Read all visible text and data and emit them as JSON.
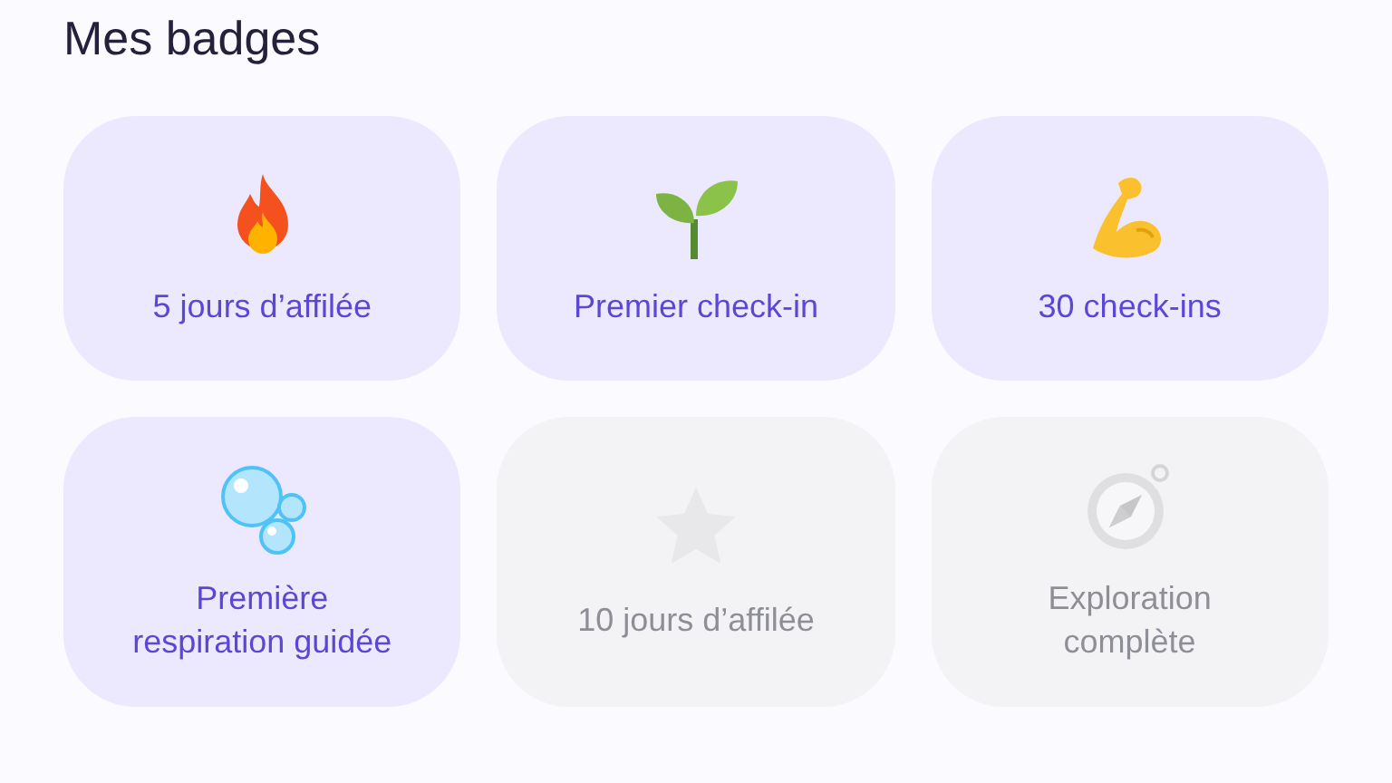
{
  "title": "Mes badges",
  "badges": [
    {
      "label": "5 jours d’affilée",
      "kind": "flame",
      "unlocked": true
    },
    {
      "label": "Premier check-in",
      "kind": "sprout",
      "unlocked": true
    },
    {
      "label": "30 check-ins",
      "kind": "arm",
      "unlocked": true
    },
    {
      "label": "Première respiration guidée",
      "kind": "bubbles",
      "unlocked": true
    },
    {
      "label": "10 jours d’affilée",
      "kind": "star",
      "unlocked": false
    },
    {
      "label": "Exploration complète",
      "kind": "compass",
      "unlocked": false
    }
  ]
}
